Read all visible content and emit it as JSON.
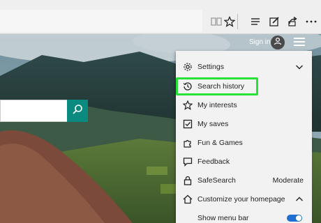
{
  "toolbar": {
    "icons": [
      "reading-view-icon",
      "favorite-star-icon",
      "hub-icon",
      "web-note-icon",
      "share-icon",
      "more-icon"
    ]
  },
  "page": {
    "signin_label": "Sign in"
  },
  "menu": {
    "items": [
      {
        "name": "settings",
        "label": "Settings",
        "icon": "gear-icon",
        "trailing": "chevron-down"
      },
      {
        "name": "search-history",
        "label": "Search history",
        "icon": "history-icon"
      },
      {
        "name": "my-interests",
        "label": "My interests",
        "icon": "star-outline-icon"
      },
      {
        "name": "my-saves",
        "label": "My saves",
        "icon": "saves-icon"
      },
      {
        "name": "fun-games",
        "label": "Fun & Games",
        "icon": "puzzle-icon"
      },
      {
        "name": "feedback",
        "label": "Feedback",
        "icon": "feedback-icon"
      },
      {
        "name": "safesearch",
        "label": "SafeSearch",
        "icon": "lock-icon",
        "value": "Moderate"
      },
      {
        "name": "customize-homepage",
        "label": "Customize your homepage",
        "icon": "home-icon",
        "trailing": "chevron-up"
      },
      {
        "name": "show-menu-bar",
        "label": "Show menu bar",
        "trailing": "toggle-on"
      }
    ]
  },
  "colors": {
    "highlight": "#27e13a",
    "search_button": "#0b8a80",
    "toggle": "#1e6fd0"
  }
}
